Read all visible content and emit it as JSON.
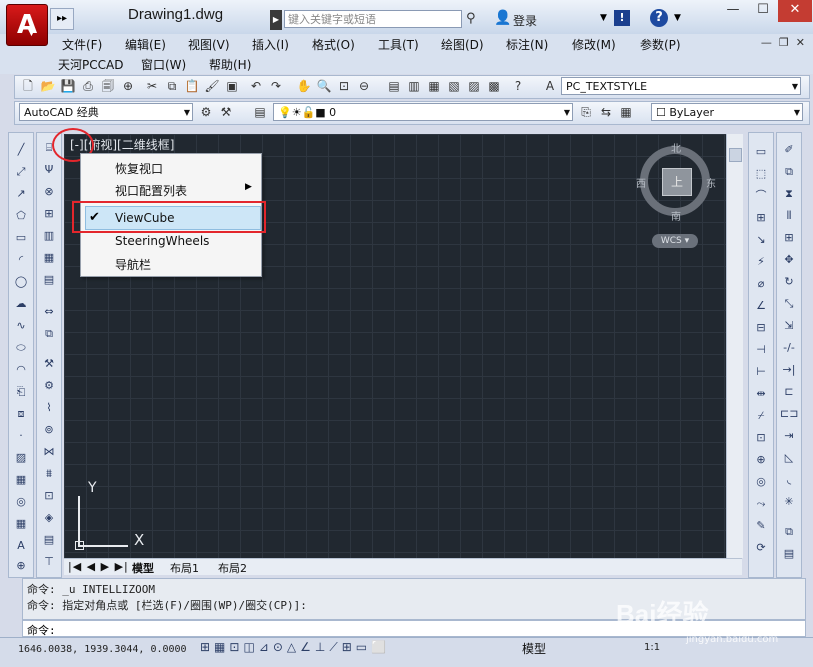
{
  "app": {
    "title": "Drawing1.dwg",
    "logo_letter": "A"
  },
  "search": {
    "placeholder": "键入关键字或短语"
  },
  "login": {
    "label": "登录"
  },
  "menu": {
    "row1": [
      "文件(F)",
      "编辑(E)",
      "视图(V)",
      "插入(I)",
      "格式(O)",
      "工具(T)",
      "绘图(D)",
      "标注(N)",
      "修改(M)",
      "参数(P)"
    ],
    "row2": [
      "天河PCCAD",
      "窗口(W)",
      "帮助(H)"
    ]
  },
  "toolbar": {
    "text_style": "PC_TEXTSTYLE",
    "workspace": "AutoCAD 经典",
    "layer": "0",
    "color": "ByLayer"
  },
  "viewport": {
    "label": "[-][俯视][二维线框]"
  },
  "viewcube": {
    "north": "北",
    "south": "南",
    "east": "东",
    "west": "西",
    "face": "上",
    "wcs": "WCS"
  },
  "context_menu": {
    "items": [
      "恢复视口",
      "视口配置列表",
      "ViewCube",
      "SteeringWheels",
      "导航栏"
    ],
    "checked_item": "ViewCube"
  },
  "ucs": {
    "x": "X",
    "y": "Y"
  },
  "tabs": [
    "模型",
    "布局1",
    "布局2"
  ],
  "command": {
    "line1": "命令: _u INTELLIZOOM",
    "line2": "命令: 指定对角点或 [栏选(F)/圈围(WP)/圈交(CP)]:",
    "prompt": "命令:"
  },
  "status": {
    "coords": "1646.0038, 1939.3044, 0.0000",
    "model": "模型",
    "scale": "1:1"
  },
  "watermark": {
    "brand": "Bai经验",
    "url": "jingyan.baidu.com"
  }
}
